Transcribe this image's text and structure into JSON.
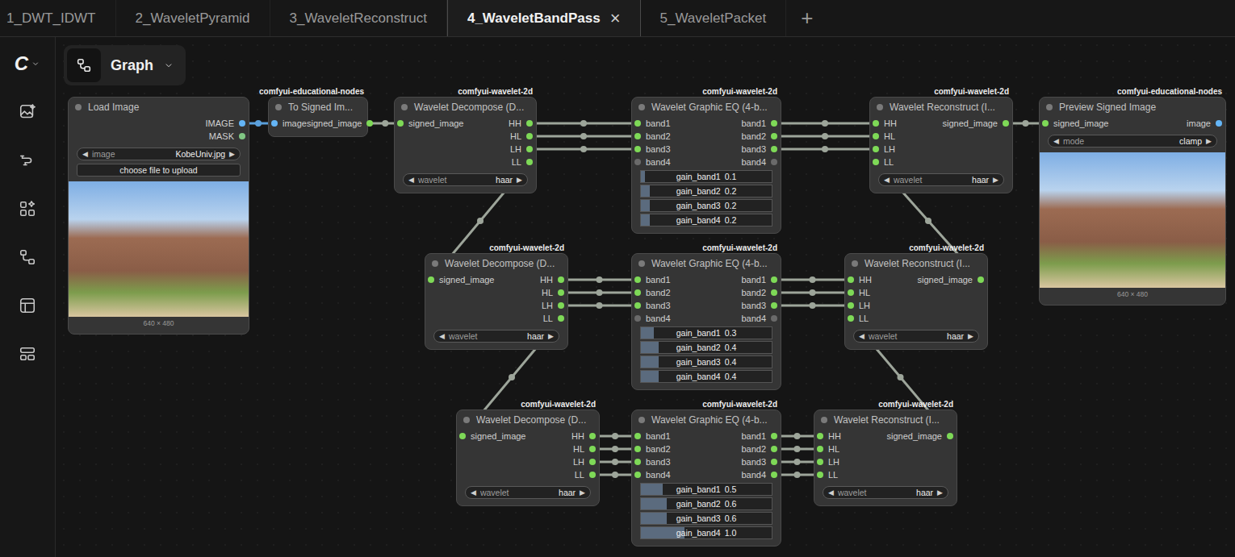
{
  "tabs": [
    {
      "label": "1_DWT_IDWT",
      "selected": false
    },
    {
      "label": "2_WaveletPyramid",
      "selected": false
    },
    {
      "label": "3_WaveletReconstruct",
      "selected": false
    },
    {
      "label": "4_WaveletBandPass",
      "selected": true,
      "close": "×"
    },
    {
      "label": "5_WaveletPacket",
      "selected": false
    }
  ],
  "add_tab": "+",
  "sidebar": {
    "logo": "C"
  },
  "breadcrumb": {
    "label": "Graph"
  },
  "nodes": [
    {
      "title": "Load Image",
      "inputs": [],
      "outputs": [
        {
          "label": "IMAGE",
          "color": "#64b5f6"
        },
        {
          "label": "MASK",
          "color": "#81c784"
        }
      ],
      "widgets": [
        {
          "kind": "combo",
          "label": "image",
          "value": "KobeUniv.jpg",
          "left": "◀",
          "right": "▶"
        },
        {
          "kind": "button",
          "label": "choose file to upload"
        },
        {
          "kind": "image",
          "caption": "640 × 480"
        }
      ]
    },
    {
      "title": "To Signed Im...",
      "badge": "comfyui-educational-nodes",
      "inputs": [
        {
          "label": "image",
          "color": "#64b5f6"
        }
      ],
      "outputs": [
        {
          "label": "signed_image",
          "color": "#7ed957"
        }
      ],
      "widgets": []
    },
    {
      "title": "Wavelet Decompose (D...",
      "badge": "comfyui-wavelet-2d",
      "inputs": [
        {
          "label": "signed_image",
          "color": "#7ed957"
        }
      ],
      "outputs": [
        {
          "label": "HH",
          "color": "#7ed957"
        },
        {
          "label": "HL",
          "color": "#7ed957"
        },
        {
          "label": "LH",
          "color": "#7ed957"
        },
        {
          "label": "LL",
          "color": "#7ed957"
        }
      ],
      "widgets": [
        {
          "kind": "combo",
          "label": "wavelet",
          "value": "haar",
          "left": "◀",
          "right": "▶"
        }
      ]
    },
    {
      "title": "Wavelet Graphic EQ (4-b...",
      "badge": "comfyui-wavelet-2d",
      "inputs": [
        {
          "label": "band1",
          "color": "#7ed957"
        },
        {
          "label": "band2",
          "color": "#7ed957"
        },
        {
          "label": "band3",
          "color": "#7ed957"
        },
        {
          "label": "band4",
          "color": "#6a6a6a"
        }
      ],
      "outputs": [
        {
          "label": "band1",
          "color": "#7ed957"
        },
        {
          "label": "band2",
          "color": "#7ed957"
        },
        {
          "label": "band3",
          "color": "#7ed957"
        },
        {
          "label": "band4",
          "color": "#6a6a6a"
        }
      ],
      "widgets": [
        {
          "kind": "slider",
          "label": "gain_band1",
          "value": "0.1",
          "level": 0.033
        },
        {
          "kind": "slider",
          "label": "gain_band2",
          "value": "0.2",
          "level": 0.067
        },
        {
          "kind": "slider",
          "label": "gain_band3",
          "value": "0.2",
          "level": 0.067
        },
        {
          "kind": "slider",
          "label": "gain_band4",
          "value": "0.2",
          "level": 0.067
        }
      ]
    },
    {
      "title": "Wavelet Reconstruct (I...",
      "badge": "comfyui-wavelet-2d",
      "inputs": [
        {
          "label": "HH",
          "color": "#7ed957"
        },
        {
          "label": "HL",
          "color": "#7ed957"
        },
        {
          "label": "LH",
          "color": "#7ed957"
        },
        {
          "label": "LL",
          "color": "#7ed957"
        }
      ],
      "outputs": [
        {
          "label": "signed_image",
          "color": "#7ed957"
        }
      ],
      "widgets": [
        {
          "kind": "combo",
          "label": "wavelet",
          "value": "haar",
          "left": "◀",
          "right": "▶"
        }
      ]
    },
    {
      "title": "Preview Signed Image",
      "badge": "comfyui-educational-nodes",
      "inputs": [
        {
          "label": "signed_image",
          "color": "#7ed957"
        }
      ],
      "outputs": [
        {
          "label": "image",
          "color": "#64b5f6"
        }
      ],
      "widgets": [
        {
          "kind": "combo",
          "label": "mode",
          "value": "clamp",
          "left": "◀",
          "right": "▶"
        },
        {
          "kind": "image",
          "caption": "640 × 480"
        }
      ]
    },
    {
      "title": "Wavelet Decompose (D...",
      "badge": "comfyui-wavelet-2d",
      "inputs": [
        {
          "label": "signed_image",
          "color": "#7ed957"
        }
      ],
      "outputs": [
        {
          "label": "HH",
          "color": "#7ed957"
        },
        {
          "label": "HL",
          "color": "#7ed957"
        },
        {
          "label": "LH",
          "color": "#7ed957"
        },
        {
          "label": "LL",
          "color": "#7ed957"
        }
      ],
      "widgets": [
        {
          "kind": "combo",
          "label": "wavelet",
          "value": "haar",
          "left": "◀",
          "right": "▶"
        }
      ]
    },
    {
      "title": "Wavelet Graphic EQ (4-b...",
      "badge": "comfyui-wavelet-2d",
      "inputs": [
        {
          "label": "band1",
          "color": "#7ed957"
        },
        {
          "label": "band2",
          "color": "#7ed957"
        },
        {
          "label": "band3",
          "color": "#7ed957"
        },
        {
          "label": "band4",
          "color": "#6a6a6a"
        }
      ],
      "outputs": [
        {
          "label": "band1",
          "color": "#7ed957"
        },
        {
          "label": "band2",
          "color": "#7ed957"
        },
        {
          "label": "band3",
          "color": "#7ed957"
        },
        {
          "label": "band4",
          "color": "#6a6a6a"
        }
      ],
      "widgets": [
        {
          "kind": "slider",
          "label": "gain_band1",
          "value": "0.3",
          "level": 0.1
        },
        {
          "kind": "slider",
          "label": "gain_band2",
          "value": "0.4",
          "level": 0.133
        },
        {
          "kind": "slider",
          "label": "gain_band3",
          "value": "0.4",
          "level": 0.133
        },
        {
          "kind": "slider",
          "label": "gain_band4",
          "value": "0.4",
          "level": 0.133
        }
      ]
    },
    {
      "title": "Wavelet Reconstruct (I...",
      "badge": "comfyui-wavelet-2d",
      "inputs": [
        {
          "label": "HH",
          "color": "#7ed957"
        },
        {
          "label": "HL",
          "color": "#7ed957"
        },
        {
          "label": "LH",
          "color": "#7ed957"
        },
        {
          "label": "LL",
          "color": "#7ed957"
        }
      ],
      "outputs": [
        {
          "label": "signed_image",
          "color": "#7ed957"
        }
      ],
      "widgets": [
        {
          "kind": "combo",
          "label": "wavelet",
          "value": "haar",
          "left": "◀",
          "right": "▶"
        }
      ]
    },
    {
      "title": "Wavelet Decompose (D...",
      "badge": "comfyui-wavelet-2d",
      "inputs": [
        {
          "label": "signed_image",
          "color": "#7ed957"
        }
      ],
      "outputs": [
        {
          "label": "HH",
          "color": "#7ed957"
        },
        {
          "label": "HL",
          "color": "#7ed957"
        },
        {
          "label": "LH",
          "color": "#7ed957"
        },
        {
          "label": "LL",
          "color": "#7ed957"
        }
      ],
      "widgets": [
        {
          "kind": "combo",
          "label": "wavelet",
          "value": "haar",
          "left": "◀",
          "right": "▶"
        }
      ]
    },
    {
      "title": "Wavelet Graphic EQ (4-b...",
      "badge": "comfyui-wavelet-2d",
      "inputs": [
        {
          "label": "band1",
          "color": "#7ed957"
        },
        {
          "label": "band2",
          "color": "#7ed957"
        },
        {
          "label": "band3",
          "color": "#7ed957"
        },
        {
          "label": "band4",
          "color": "#7ed957"
        }
      ],
      "outputs": [
        {
          "label": "band1",
          "color": "#7ed957"
        },
        {
          "label": "band2",
          "color": "#7ed957"
        },
        {
          "label": "band3",
          "color": "#7ed957"
        },
        {
          "label": "band4",
          "color": "#7ed957"
        }
      ],
      "widgets": [
        {
          "kind": "slider",
          "label": "gain_band1",
          "value": "0.5",
          "level": 0.167
        },
        {
          "kind": "slider",
          "label": "gain_band2",
          "value": "0.6",
          "level": 0.2
        },
        {
          "kind": "slider",
          "label": "gain_band3",
          "value": "0.6",
          "level": 0.2
        },
        {
          "kind": "slider",
          "label": "gain_band4",
          "value": "1.0",
          "level": 0.333
        }
      ]
    },
    {
      "title": "Wavelet Reconstruct (I...",
      "badge": "comfyui-wavelet-2d",
      "inputs": [
        {
          "label": "HH",
          "color": "#7ed957"
        },
        {
          "label": "HL",
          "color": "#7ed957"
        },
        {
          "label": "LH",
          "color": "#7ed957"
        },
        {
          "label": "LL",
          "color": "#7ed957"
        }
      ],
      "outputs": [
        {
          "label": "signed_image",
          "color": "#7ed957"
        }
      ],
      "widgets": [
        {
          "kind": "combo",
          "label": "wavelet",
          "value": "haar",
          "left": "◀",
          "right": "▶"
        }
      ]
    }
  ],
  "links": [
    {
      "from": [
        0,
        0
      ],
      "to": [
        1,
        0
      ],
      "color": "#5aa0dc"
    },
    {
      "from": [
        1,
        0
      ],
      "to": [
        2,
        0
      ],
      "color": "#9da59a"
    },
    {
      "from": [
        2,
        0
      ],
      "to": [
        3,
        0
      ],
      "color": "#9da59a"
    },
    {
      "from": [
        2,
        1
      ],
      "to": [
        3,
        1
      ],
      "color": "#9da59a"
    },
    {
      "from": [
        2,
        2
      ],
      "to": [
        3,
        2
      ],
      "color": "#9da59a"
    },
    {
      "from": [
        3,
        0
      ],
      "to": [
        4,
        0
      ],
      "color": "#9da59a"
    },
    {
      "from": [
        3,
        1
      ],
      "to": [
        4,
        1
      ],
      "color": "#9da59a"
    },
    {
      "from": [
        3,
        2
      ],
      "to": [
        4,
        2
      ],
      "color": "#9da59a"
    },
    {
      "from": [
        4,
        0
      ],
      "to": [
        5,
        0
      ],
      "color": "#9da59a"
    },
    {
      "from": [
        2,
        3
      ],
      "to": [
        6,
        0
      ],
      "color": "#9da59a"
    },
    {
      "from": [
        6,
        0
      ],
      "to": [
        7,
        0
      ],
      "color": "#9da59a"
    },
    {
      "from": [
        6,
        1
      ],
      "to": [
        7,
        1
      ],
      "color": "#9da59a"
    },
    {
      "from": [
        6,
        2
      ],
      "to": [
        7,
        2
      ],
      "color": "#9da59a"
    },
    {
      "from": [
        7,
        0
      ],
      "to": [
        8,
        0
      ],
      "color": "#9da59a"
    },
    {
      "from": [
        7,
        1
      ],
      "to": [
        8,
        1
      ],
      "color": "#9da59a"
    },
    {
      "from": [
        7,
        2
      ],
      "to": [
        8,
        2
      ],
      "color": "#9da59a"
    },
    {
      "from": [
        8,
        0
      ],
      "to": [
        4,
        3
      ],
      "color": "#9da59a"
    },
    {
      "from": [
        6,
        3
      ],
      "to": [
        9,
        0
      ],
      "color": "#9da59a"
    },
    {
      "from": [
        9,
        0
      ],
      "to": [
        10,
        0
      ],
      "color": "#9da59a"
    },
    {
      "from": [
        9,
        1
      ],
      "to": [
        10,
        1
      ],
      "color": "#9da59a"
    },
    {
      "from": [
        9,
        2
      ],
      "to": [
        10,
        2
      ],
      "color": "#9da59a"
    },
    {
      "from": [
        9,
        3
      ],
      "to": [
        10,
        3
      ],
      "color": "#9da59a"
    },
    {
      "from": [
        10,
        0
      ],
      "to": [
        11,
        0
      ],
      "color": "#9da59a"
    },
    {
      "from": [
        10,
        1
      ],
      "to": [
        11,
        1
      ],
      "color": "#9da59a"
    },
    {
      "from": [
        10,
        2
      ],
      "to": [
        11,
        2
      ],
      "color": "#9da59a"
    },
    {
      "from": [
        10,
        3
      ],
      "to": [
        11,
        3
      ],
      "color": "#9da59a"
    },
    {
      "from": [
        11,
        0
      ],
      "to": [
        8,
        3
      ],
      "color": "#9da59a"
    }
  ]
}
